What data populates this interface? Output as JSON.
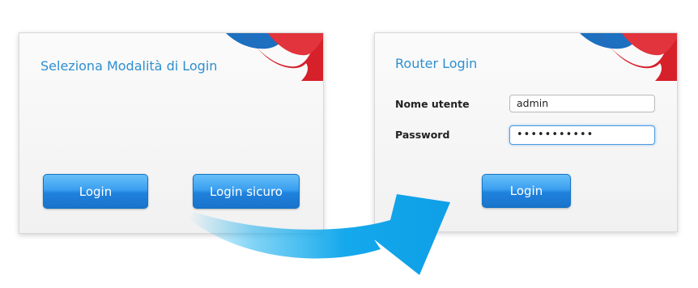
{
  "left_panel": {
    "title": "Seleziona Modalità di Login",
    "login_label": "Login",
    "secure_login_label": "Login sicuro"
  },
  "right_panel": {
    "title": "Router Login",
    "username_label": "Nome utente",
    "username_value": "admin",
    "password_label": "Password",
    "password_value": "•••••••••••",
    "login_label": "Login"
  },
  "colors": {
    "title_blue": "#2d8fd1",
    "button_blue": "#1f82dd",
    "arrow_cyan": "#1ab0ee",
    "logo_red": "#d6202a",
    "logo_blue": "#1d6fc0"
  },
  "icons": {
    "logo": "brand-swoosh-icon",
    "arrow": "curved-arrow-icon"
  }
}
